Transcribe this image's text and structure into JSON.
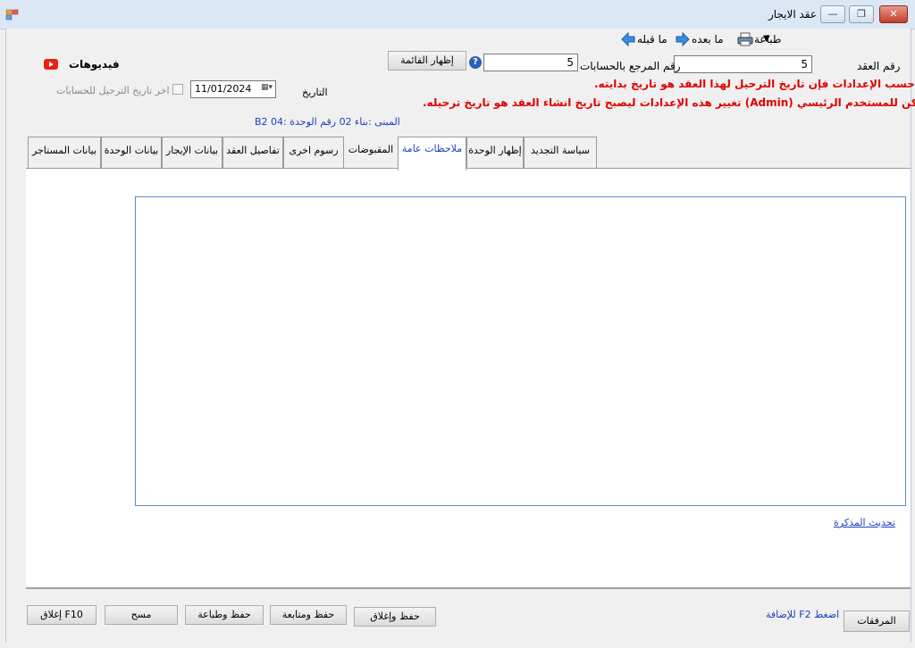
{
  "window": {
    "title": "عقد الايجار",
    "min": "—",
    "max": "❐",
    "close": "✕"
  },
  "toolbar": {
    "print": "طباعة",
    "next": "ما بعده",
    "prev": "ما قبله"
  },
  "contract_no": {
    "label": "رقم العقد",
    "value": "5"
  },
  "ref_no": {
    "label": "رقم المرجع بالحسابات",
    "value": "5",
    "help": "?"
  },
  "show_list_button": "إظهار القائمة",
  "videos": {
    "label": "فيديوهات"
  },
  "date": {
    "label": "التاريخ",
    "value": "11/01/2024"
  },
  "last_posting": {
    "label": "اخر تاريخ الترحيل للحسابات"
  },
  "warning_1": "حسب الإعدادات فإن تاريخ الترحيل لهذا العقد هو تاريخ بدايته.",
  "warning_2": "يمكن للمستخدم الرئيسي (Admin) تغيير هذه الإعدادات ليصبح تاريخ انشاء العقد هو تاريخ ترحيله.",
  "unit_info": "المبنى :بناء 02 رقم الوحدة :B2 04",
  "tabs": [
    "بيانات المستاجر",
    "بيانات الوحدة",
    "بيانات الإيجار",
    "تفاصيل العقد",
    "رسوم اخرى",
    "المقبوضات",
    "ملاحظات عامة",
    "إظهار الوحدة",
    "سياسة التجديد"
  ],
  "memo_refresh_link": "تحديث المذكرة",
  "footer": {
    "attachments": "المرفقات",
    "hint": "اضغط F2 للإضافة",
    "save_close": "حفظ وإغلاق",
    "save_continue": "حفظ ومتابعة",
    "save_print": "حفظ وطباعة",
    "clear": "مسح",
    "close": "إغلاق F10"
  },
  "colors": {
    "warning": "#e00000",
    "link": "#1a3fbf",
    "title_bar": "#dce7f5"
  }
}
